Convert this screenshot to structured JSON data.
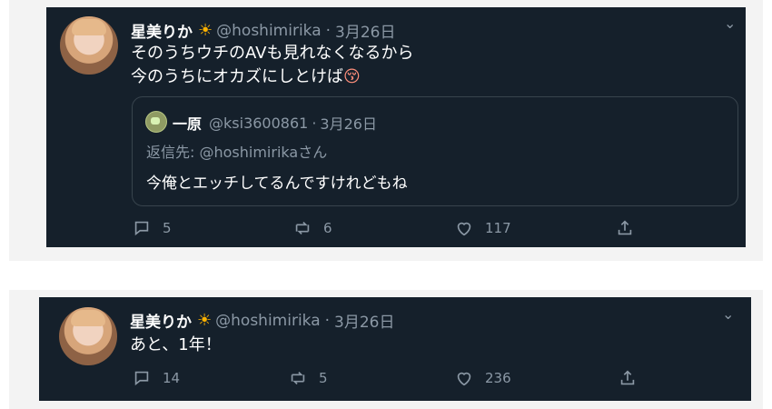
{
  "tweets": [
    {
      "name": "星美りか",
      "badge": "sun-emoji",
      "handle": "@hoshimirika",
      "date": "3月26日",
      "lines": [
        "そのうちウチのAVも見れなくなるから",
        "今のうちにオカズにしとけば"
      ],
      "emoji": "😚",
      "quote": {
        "name": "一原",
        "handle": "@ksi3600861",
        "date": "3月26日",
        "reply_prefix": "返信先: ",
        "reply_to": "@hoshimirika",
        "reply_suffix": "さん",
        "text": "今俺とエッチしてるんですけれどもね"
      },
      "replies": "5",
      "retweets": "6",
      "likes": "117"
    },
    {
      "name": "星美りか",
      "badge": "sun-emoji",
      "handle": "@hoshimirika",
      "date": "3月26日",
      "lines": [
        "あと、1年！"
      ],
      "replies": "14",
      "retweets": "5",
      "likes": "236"
    }
  ],
  "colors": {
    "card_bg": "#15202b",
    "text": "#ffffff",
    "muted": "#8b98a5",
    "border": "#38444d"
  }
}
